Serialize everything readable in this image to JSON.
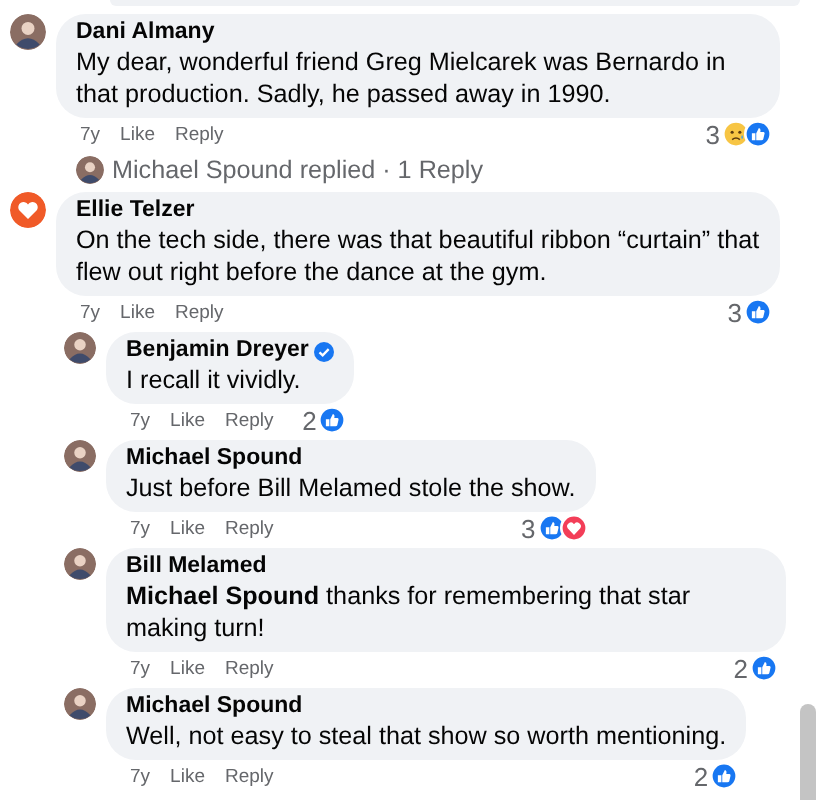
{
  "comments": [
    {
      "author": "Dani Almany",
      "avatar": {
        "kind": "photo"
      },
      "verified": false,
      "text": "My dear, wonderful friend Greg Mielcarek was Bernardo in that production. Sadly, he passed away in 1990.",
      "time": "7y",
      "like": "Like",
      "reply": "Reply",
      "reactions": {
        "count": "3",
        "types": [
          {
            "kind": "sad"
          },
          {
            "kind": "like"
          }
        ]
      },
      "replies_summary": "Michael Spound replied · 1 Reply"
    },
    {
      "author": "Ellie Telzer",
      "avatar": {
        "kind": "heart"
      },
      "verified": false,
      "text": "On the tech side, there was that beautiful ribbon “curtain” that flew out right before the dance at the gym.",
      "time": "7y",
      "like": "Like",
      "reply": "Reply",
      "reactions": {
        "count": "3",
        "types": [
          {
            "kind": "like"
          }
        ]
      },
      "children": [
        {
          "author": "Benjamin Dreyer",
          "avatar": {
            "kind": "photo"
          },
          "verified": true,
          "text": "I recall it vividly.",
          "time": "7y",
          "like": "Like",
          "reply": "Reply",
          "reactions": {
            "count": "2",
            "types": [
              {
                "kind": "like"
              }
            ]
          }
        },
        {
          "author": "Michael Spound",
          "avatar": {
            "kind": "photo"
          },
          "verified": false,
          "text": "Just before Bill Melamed stole the show.",
          "time": "7y",
          "like": "Like",
          "reply": "Reply",
          "reactions": {
            "count": "3",
            "types": [
              {
                "kind": "like"
              },
              {
                "kind": "love"
              }
            ]
          }
        },
        {
          "author": "Bill Melamed",
          "avatar": {
            "kind": "photo"
          },
          "verified": false,
          "text": "**Michael Spound** thanks for remembering that star making turn!",
          "time": "7y",
          "like": "Like",
          "reply": "Reply",
          "reactions": {
            "count": "2",
            "types": [
              {
                "kind": "like"
              }
            ]
          }
        },
        {
          "author": "Michael Spound",
          "avatar": {
            "kind": "photo"
          },
          "verified": false,
          "text": "Well, not easy to steal that show so worth mentioning.",
          "time": "7y",
          "like": "Like",
          "reply": "Reply",
          "reactions": {
            "count": "2",
            "types": [
              {
                "kind": "like"
              }
            ]
          }
        }
      ]
    }
  ]
}
